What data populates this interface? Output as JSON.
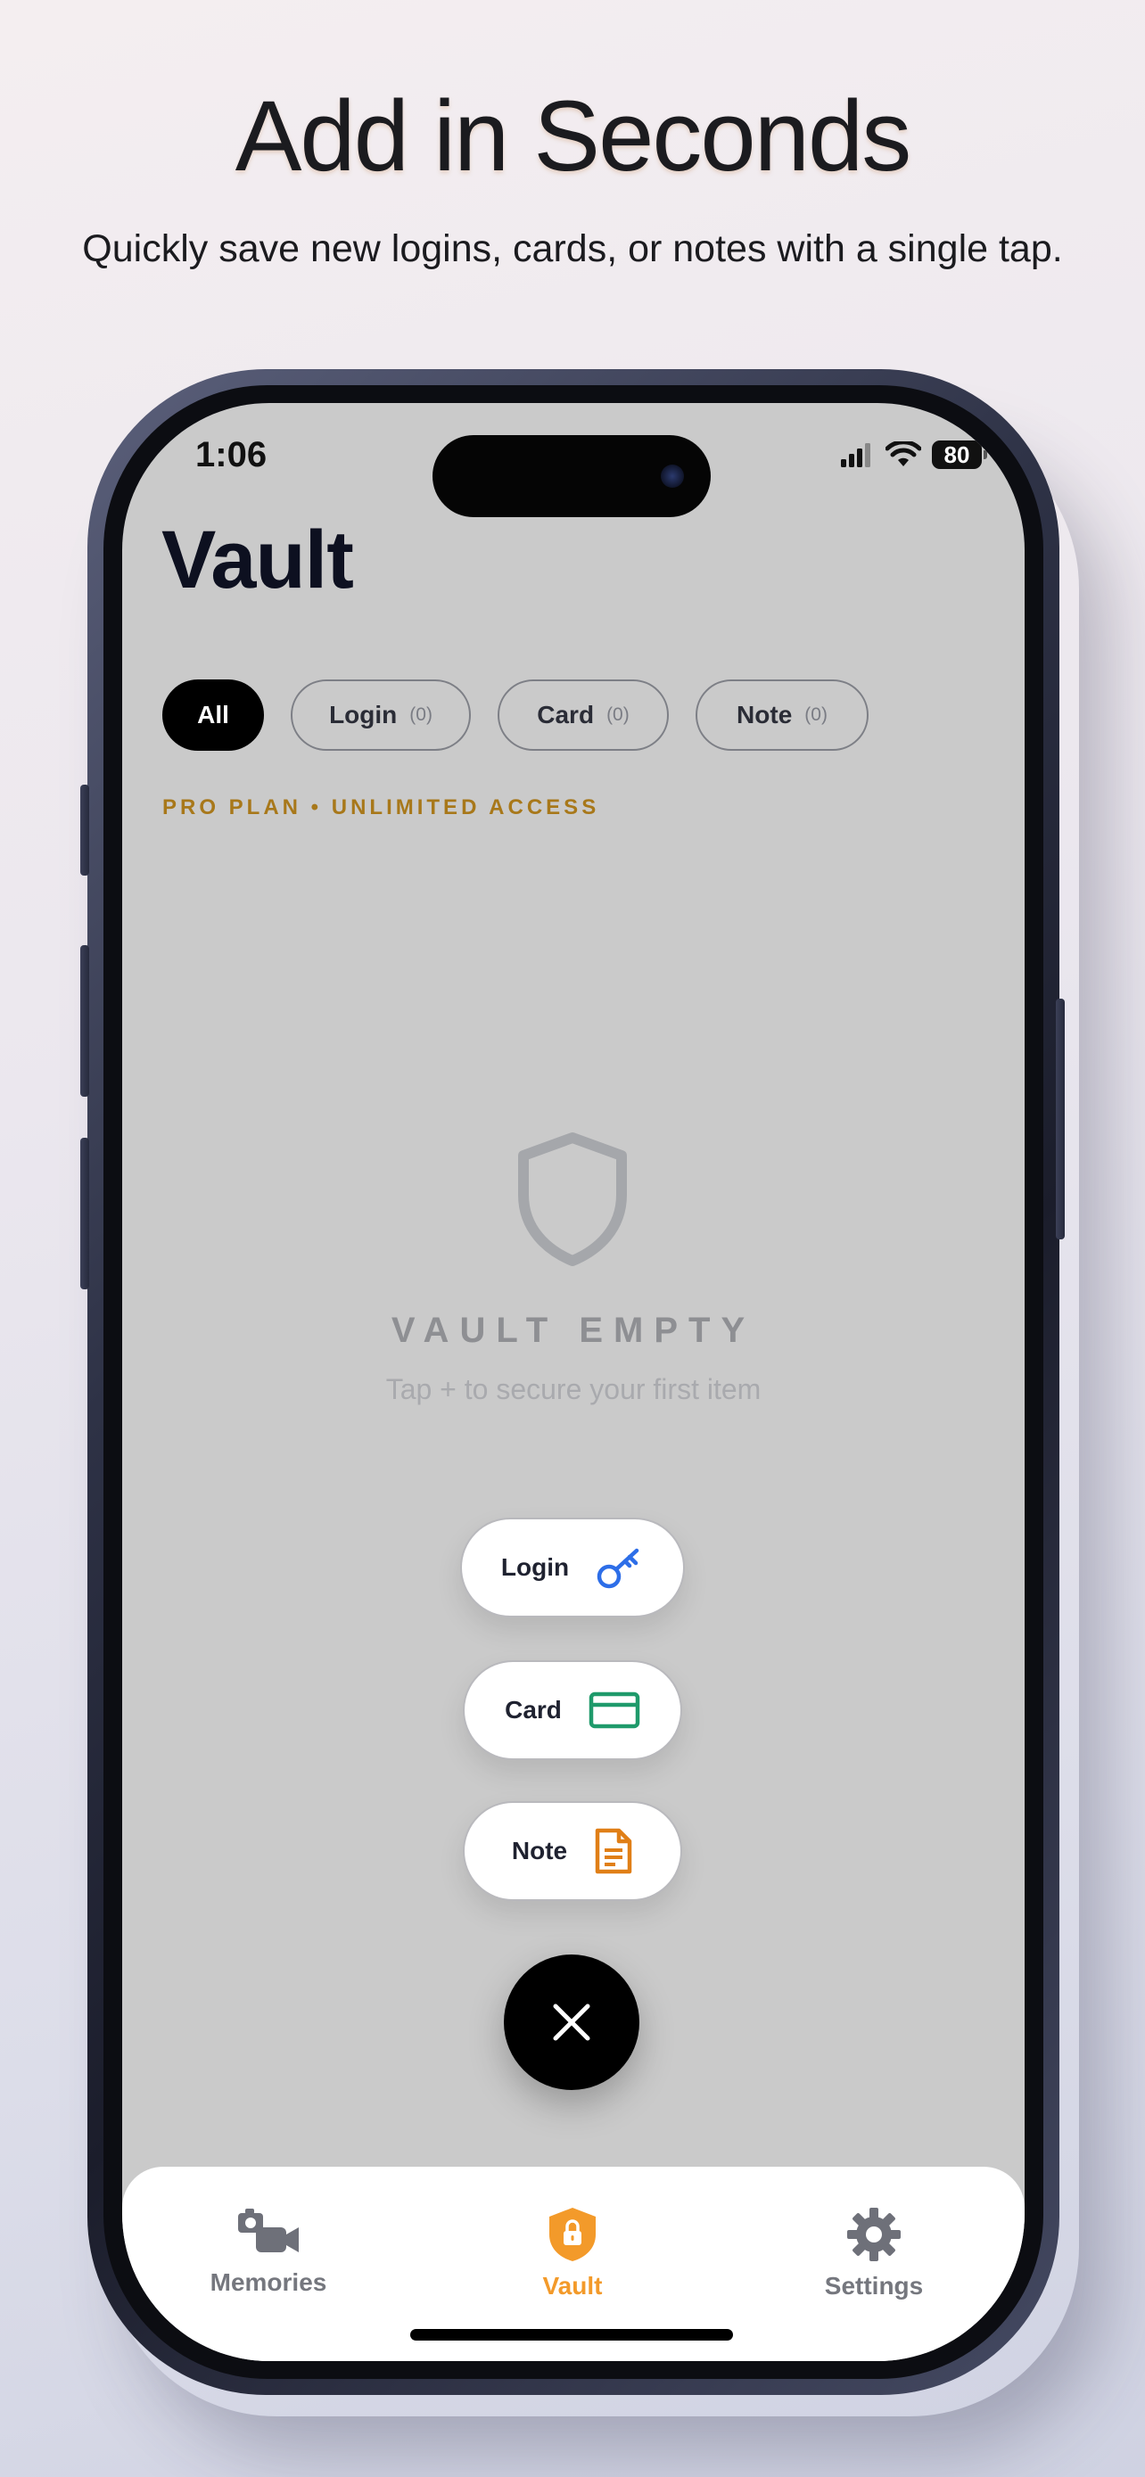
{
  "headline": {
    "title": "Add in Seconds",
    "subtitle": "Quickly save new logins, cards, or notes with a single tap."
  },
  "status_bar": {
    "time": "1:06",
    "battery": "80",
    "icons": [
      "signal-icon",
      "wifi-icon",
      "battery-icon"
    ]
  },
  "app": {
    "title": "Vault",
    "filters": [
      {
        "label": "All",
        "count": "",
        "active": true
      },
      {
        "label": "Login",
        "count": "(0)",
        "active": false
      },
      {
        "label": "Card",
        "count": "(0)",
        "active": false
      },
      {
        "label": "Note",
        "count": "(0)",
        "active": false
      }
    ],
    "plan_label": "PRO PLAN • UNLIMITED ACCESS",
    "empty_state": {
      "icon": "shield-icon",
      "title": "VAULT EMPTY",
      "subtitle": "Tap + to secure your first item"
    },
    "speed_dial": [
      {
        "label": "Login",
        "icon": "key-icon",
        "color": "#2d6ee8"
      },
      {
        "label": "Card",
        "icon": "credit-card-icon",
        "color": "#1f9a6b"
      },
      {
        "label": "Note",
        "icon": "document-icon",
        "color": "#e07f17"
      }
    ],
    "close_icon": "close-icon"
  },
  "tab_bar": {
    "tabs": [
      {
        "label": "Memories",
        "icon": "camera-video-icon",
        "active": false
      },
      {
        "label": "Vault",
        "icon": "lock-shield-icon",
        "active": true
      },
      {
        "label": "Settings",
        "icon": "gear-icon",
        "active": false
      }
    ],
    "active_color": "#f39a2a"
  }
}
